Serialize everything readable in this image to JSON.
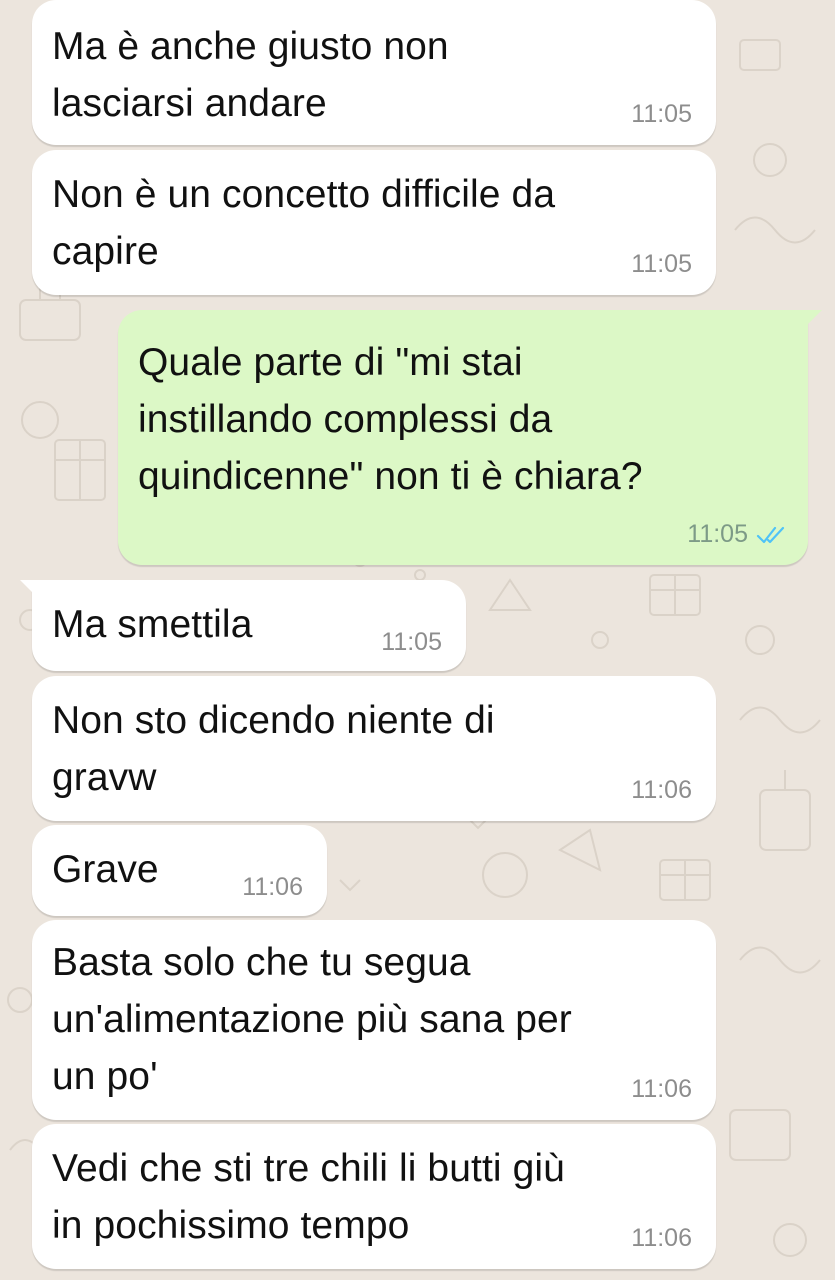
{
  "chat": {
    "messages": [
      {
        "direction": "in",
        "text": "Ma è anche giusto non\nlasciarsi andare",
        "time": "11:05"
      },
      {
        "direction": "in",
        "text": "Non è un concetto difficile da\ncapire",
        "time": "11:05"
      },
      {
        "direction": "out",
        "text": "Quale parte di \"mi stai\ninstillando complessi da\nquindicenne\" non ti è chiara?",
        "time": "11:05",
        "status": "read",
        "status_icon": "double-check-icon",
        "status_color": "#4fc3f7"
      },
      {
        "direction": "in",
        "text": "Ma smettila",
        "time": "11:05"
      },
      {
        "direction": "in",
        "text": "Non sto dicendo niente di\ngravw",
        "time": "11:06"
      },
      {
        "direction": "in",
        "text": "Grave",
        "time": "11:06"
      },
      {
        "direction": "in",
        "text": "Basta solo che tu segua\nun'alimentazione più sana per\nun po'",
        "time": "11:06"
      },
      {
        "direction": "in",
        "text": "Vedi che sti tre chili li butti giù\nin pochissimo tempo",
        "time": "11:06"
      }
    ]
  },
  "colors": {
    "background": "#ece5dd",
    "incoming_bubble": "#ffffff",
    "outgoing_bubble": "#dcf8c6",
    "read_ticks": "#4fc3f7"
  }
}
